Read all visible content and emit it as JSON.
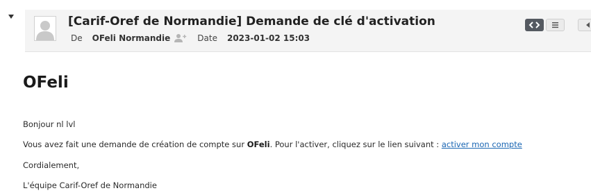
{
  "header": {
    "subject": "[Carif-Oref de Normandie] Demande de clé d'activation",
    "from_label": "De",
    "from_value": "OFeli Normandie",
    "date_label": "Date",
    "date_value": "2023-01-02 15:03"
  },
  "toolbar": {
    "source_icon": "code-icon",
    "plain_icon": "menu-lines-icon",
    "next_icon": "arrow-left-icon"
  },
  "body": {
    "title": "OFeli",
    "greeting": "Bonjour nl lvl",
    "line1_before": "Vous avez fait une demande de création de compte sur ",
    "line1_bold": "OFeli",
    "line1_after": ". Pour l'activer, cliquez sur le lien suivant : ",
    "line1_link": "activer mon compte",
    "closing": "Cordialement,",
    "signature": "L'équipe Carif-Oref de Normandie"
  },
  "colors": {
    "header_bg": "#f4f4f4",
    "link": "#1a66b3",
    "source_button": "#555a61"
  }
}
